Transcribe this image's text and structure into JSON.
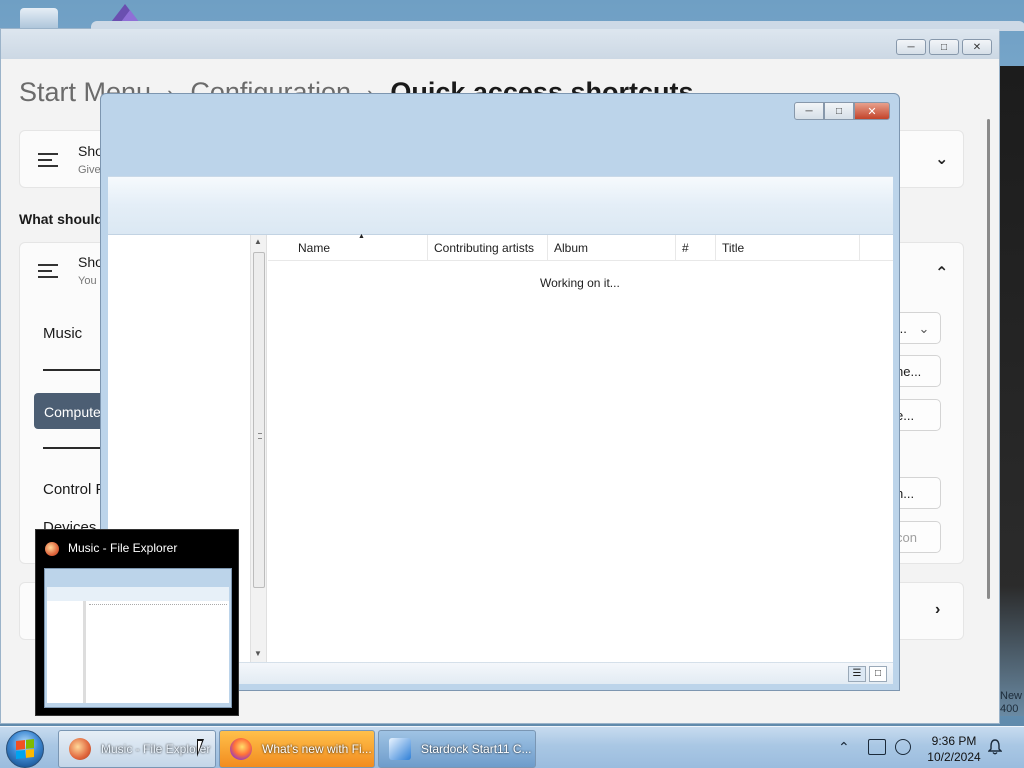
{
  "settings": {
    "breadcrumb": {
      "item1": "Start Menu",
      "item2": "Configuration",
      "current": "Quick access shortcuts",
      "separator": "›"
    },
    "card1": {
      "title": "Sho",
      "subtitle": "Give"
    },
    "section_heading": "What should",
    "card2": {
      "title": "Sho",
      "subtitle": "You"
    },
    "list_items": [
      "Music",
      "Compute",
      "Control P",
      "Devices"
    ],
    "right_buttons": [
      "...",
      "ne...",
      "e...",
      "n...",
      "con"
    ]
  },
  "music_window": {
    "columns": [
      "Name",
      "Contributing artists",
      "Album",
      "#",
      "Title"
    ],
    "status_message": "Working on it..."
  },
  "thumbnail": {
    "title": "Music - File Explorer"
  },
  "taskbar": {
    "items": [
      {
        "label": "Music - File Explorer"
      },
      {
        "label": "What's new with Fi..."
      },
      {
        "label": "Stardock Start11 C..."
      }
    ],
    "clock": {
      "time": "9:36 PM",
      "date": "10/2/2024"
    }
  },
  "desktop": {
    "side_text": "New 400"
  },
  "colors": {
    "taskbar_top": "#c7dbef",
    "selected_item": "#4c5e73",
    "window_frame": "#bcd4ea",
    "close_button": "#c3442a"
  }
}
